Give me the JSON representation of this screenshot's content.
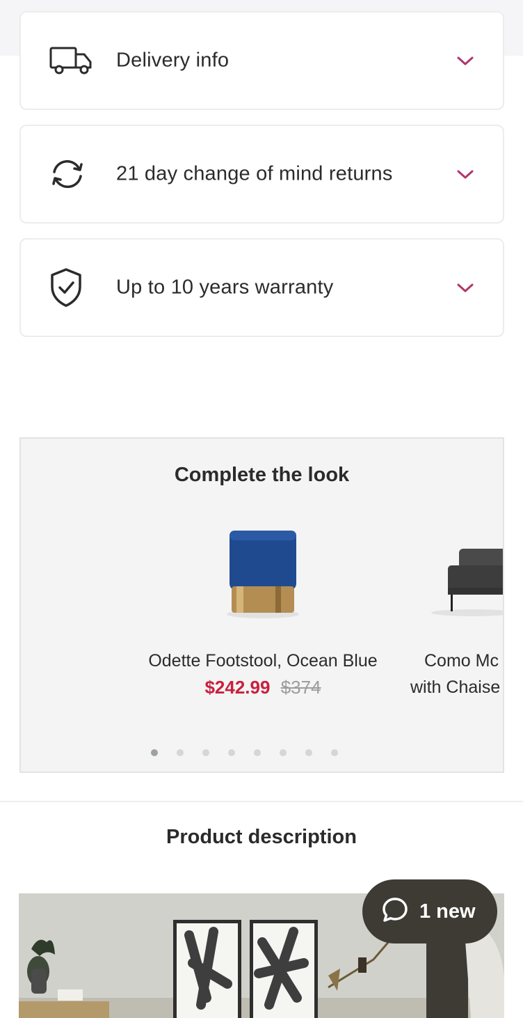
{
  "accordions": [
    {
      "label": "Delivery info",
      "icon": "truck-icon"
    },
    {
      "label": "21 day change of mind returns",
      "icon": "returns-cycle-icon"
    },
    {
      "label": "Up to 10 years warranty",
      "icon": "shield-check-icon"
    }
  ],
  "complete_the_look": {
    "title": "Complete the look",
    "products": [
      {
        "name": "Odette Footstool, Ocean Blue",
        "price": "$242.99",
        "was_price": "$374"
      },
      {
        "name_line1": "Como Mc",
        "name_line2": "with Chaise"
      }
    ],
    "carousel_total": 8,
    "carousel_active": 1
  },
  "product_description": {
    "title": "Product description"
  },
  "chat": {
    "label": "1 new",
    "icon": "chat-bubble-icon"
  },
  "colors": {
    "accent": "#b0366b",
    "sale_price": "#c8203e",
    "chat_bg": "#3e3b35"
  }
}
